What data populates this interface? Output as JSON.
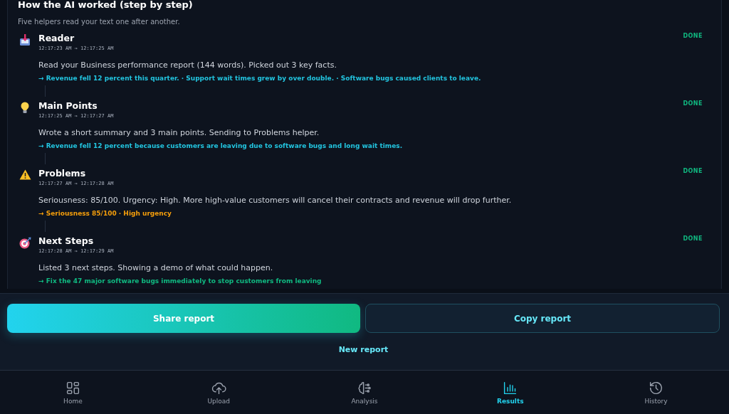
{
  "panel": {
    "title": "How the AI worked (step by step)",
    "subtitle": "Five helpers read your text one after another."
  },
  "steps": [
    {
      "kind": "tray",
      "name": "Reader",
      "time": "12:17:23 AM → 12:17:25 AM",
      "description": "Read your Business performance report (144 words). Picked out 3 key facts.",
      "result": "→ Revenue fell 12 percent this quarter. · Support wait times grew by over double. · Software bugs caused clients to leave.",
      "color": "#22c5e0",
      "status": "DONE"
    },
    {
      "kind": "bulb",
      "name": "Main Points",
      "time": "12:17:25 AM → 12:17:27 AM",
      "description": "Wrote a short summary and 3 main points. Sending to Problems helper.",
      "result": "→ Revenue fell 12 percent because customers are leaving due to software bugs and long wait times.",
      "color": "#22c5e0",
      "status": "DONE"
    },
    {
      "kind": "warning",
      "name": "Problems",
      "time": "12:17:27 AM → 12:17:28 AM",
      "description": "Seriousness: 85/100. Urgency: High. More high-value customers will cancel their contracts and revenue will drop further.",
      "result": "→ Seriousness 85/100 · High urgency",
      "color": "#f59e0b",
      "status": "DONE"
    },
    {
      "kind": "target",
      "name": "Next Steps",
      "time": "12:17:28 AM → 12:17:29 AM",
      "description": "Listed 3 next steps. Showing a demo of what could happen.",
      "result": "→ Fix the 47 major software bugs immediately to stop customers from leaving",
      "color": "#10b981",
      "status": "DONE"
    }
  ],
  "actions": {
    "share": "Share report",
    "copy": "Copy report",
    "new": "New report"
  },
  "nav": [
    {
      "kind": "home",
      "label": "Home",
      "selected": false
    },
    {
      "kind": "upload",
      "label": "Upload",
      "selected": false
    },
    {
      "kind": "analysis",
      "label": "Analysis",
      "selected": false
    },
    {
      "kind": "results",
      "label": "Results",
      "selected": true
    },
    {
      "kind": "history",
      "label": "History",
      "selected": false
    }
  ]
}
